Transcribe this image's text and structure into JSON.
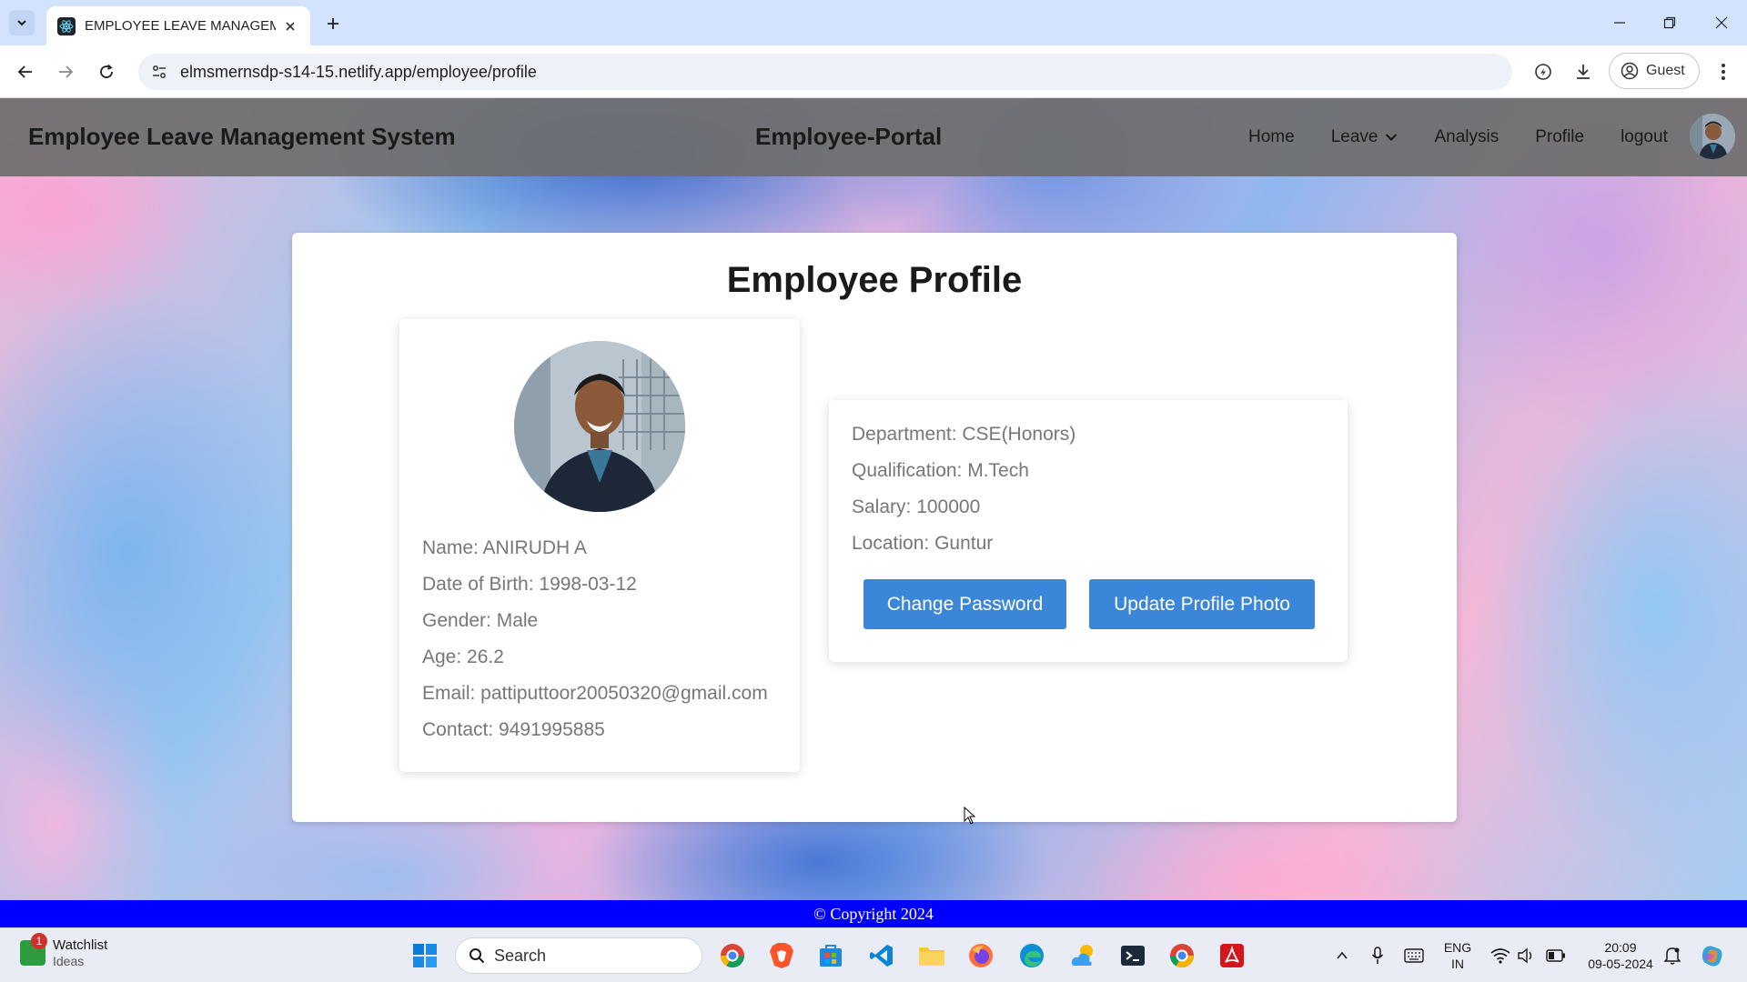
{
  "browser": {
    "tab_title": "EMPLOYEE LEAVE MANAGEMENT",
    "url": "elmsmernsdp-s14-15.netlify.app/employee/profile",
    "profile_label": "Guest"
  },
  "header": {
    "brand": "Employee Leave Management System",
    "portal": "Employee-Portal",
    "nav": {
      "home": "Home",
      "leave": "Leave",
      "analysis": "Analysis",
      "profile": "Profile",
      "logout": "logout"
    }
  },
  "profile": {
    "title": "Employee Profile",
    "name": "Name: ANIRUDH A",
    "dob": "Date of Birth: 1998-03-12",
    "gender": "Gender: Male",
    "age": "Age: 26.2",
    "email": "Email: pattiputtoor20050320@gmail.com",
    "contact": "Contact: 9491995885",
    "department": "Department: CSE(Honors)",
    "qualification": "Qualification: M.Tech",
    "salary": "Salary: 100000",
    "location": "Location: Guntur",
    "change_password": "Change Password",
    "update_photo": "Update Profile Photo"
  },
  "footer": {
    "copyright": "© Copyright 2024"
  },
  "taskbar": {
    "watchlist": "Watchlist",
    "watchlist_sub": "Ideas",
    "watchlist_badge": "1",
    "search": "Search",
    "lang_top": "ENG",
    "lang_bottom": "IN",
    "time": "20:09",
    "date": "09-05-2024"
  },
  "colors": {
    "header_bg": "#6e6e6e",
    "button": "#3b86d8",
    "footer": "#0000ff"
  }
}
